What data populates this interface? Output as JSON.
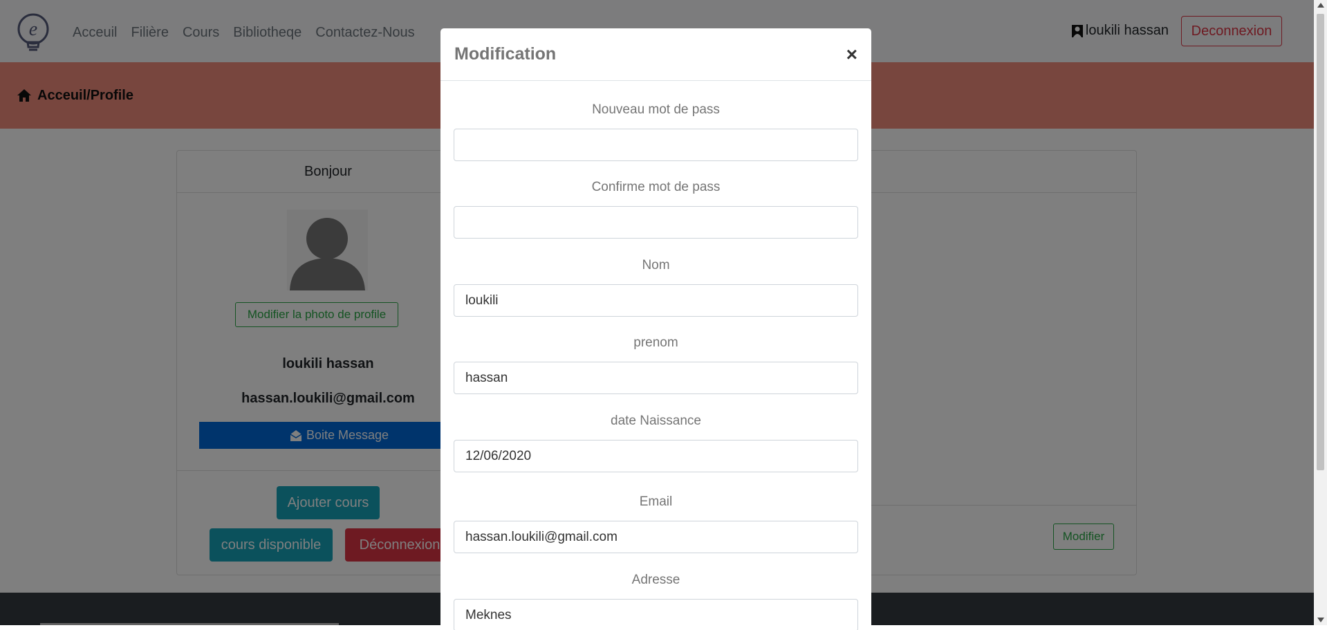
{
  "navbar": {
    "links": [
      "Acceuil",
      "Filière",
      "Cours",
      "Bibliotheqe",
      "Contactez-Nous"
    ],
    "user_label": "loukili hassan",
    "logout_label": "Deconnexion"
  },
  "banner": {
    "breadcrumb": "Acceuil/Profile"
  },
  "profile": {
    "greeting": "Bonjour",
    "change_photo_label": "Modifier la photo de profile",
    "full_name": "loukili hassan",
    "email": "hassan.loukili@gmail.com",
    "message_button": "Boite Message",
    "add_course_button": "Ajouter cours",
    "available_courses_button": "cours disponible",
    "logout_button": "Déconnexion",
    "edit_button": "Modifier"
  },
  "modal": {
    "title": "Modification",
    "close_symbol": "×",
    "fields": {
      "new_password": {
        "label": "Nouveau mot de pass",
        "value": ""
      },
      "confirm_password": {
        "label": "Confirme mot de pass",
        "value": ""
      },
      "nom": {
        "label": "Nom",
        "value": "loukili"
      },
      "prenom": {
        "label": "prenom",
        "value": "hassan"
      },
      "date_naissance": {
        "label": "date Naissance",
        "value": "12/06/2020"
      },
      "email": {
        "label": "Email",
        "value": "hassan.loukili@gmail.com"
      },
      "adresse": {
        "label": "Adresse",
        "value": "Meknes"
      }
    }
  },
  "colors": {
    "banner": "#f08d7c",
    "danger": "#dc3545",
    "success": "#28a745",
    "info": "#17a2b8",
    "primary": "#0069d9",
    "dark": "#343a40"
  },
  "icons": [
    "lightbulb-logo-icon",
    "user-icon",
    "home-icon",
    "envelope-open-icon",
    "avatar-silhouette-icon",
    "close-icon"
  ]
}
